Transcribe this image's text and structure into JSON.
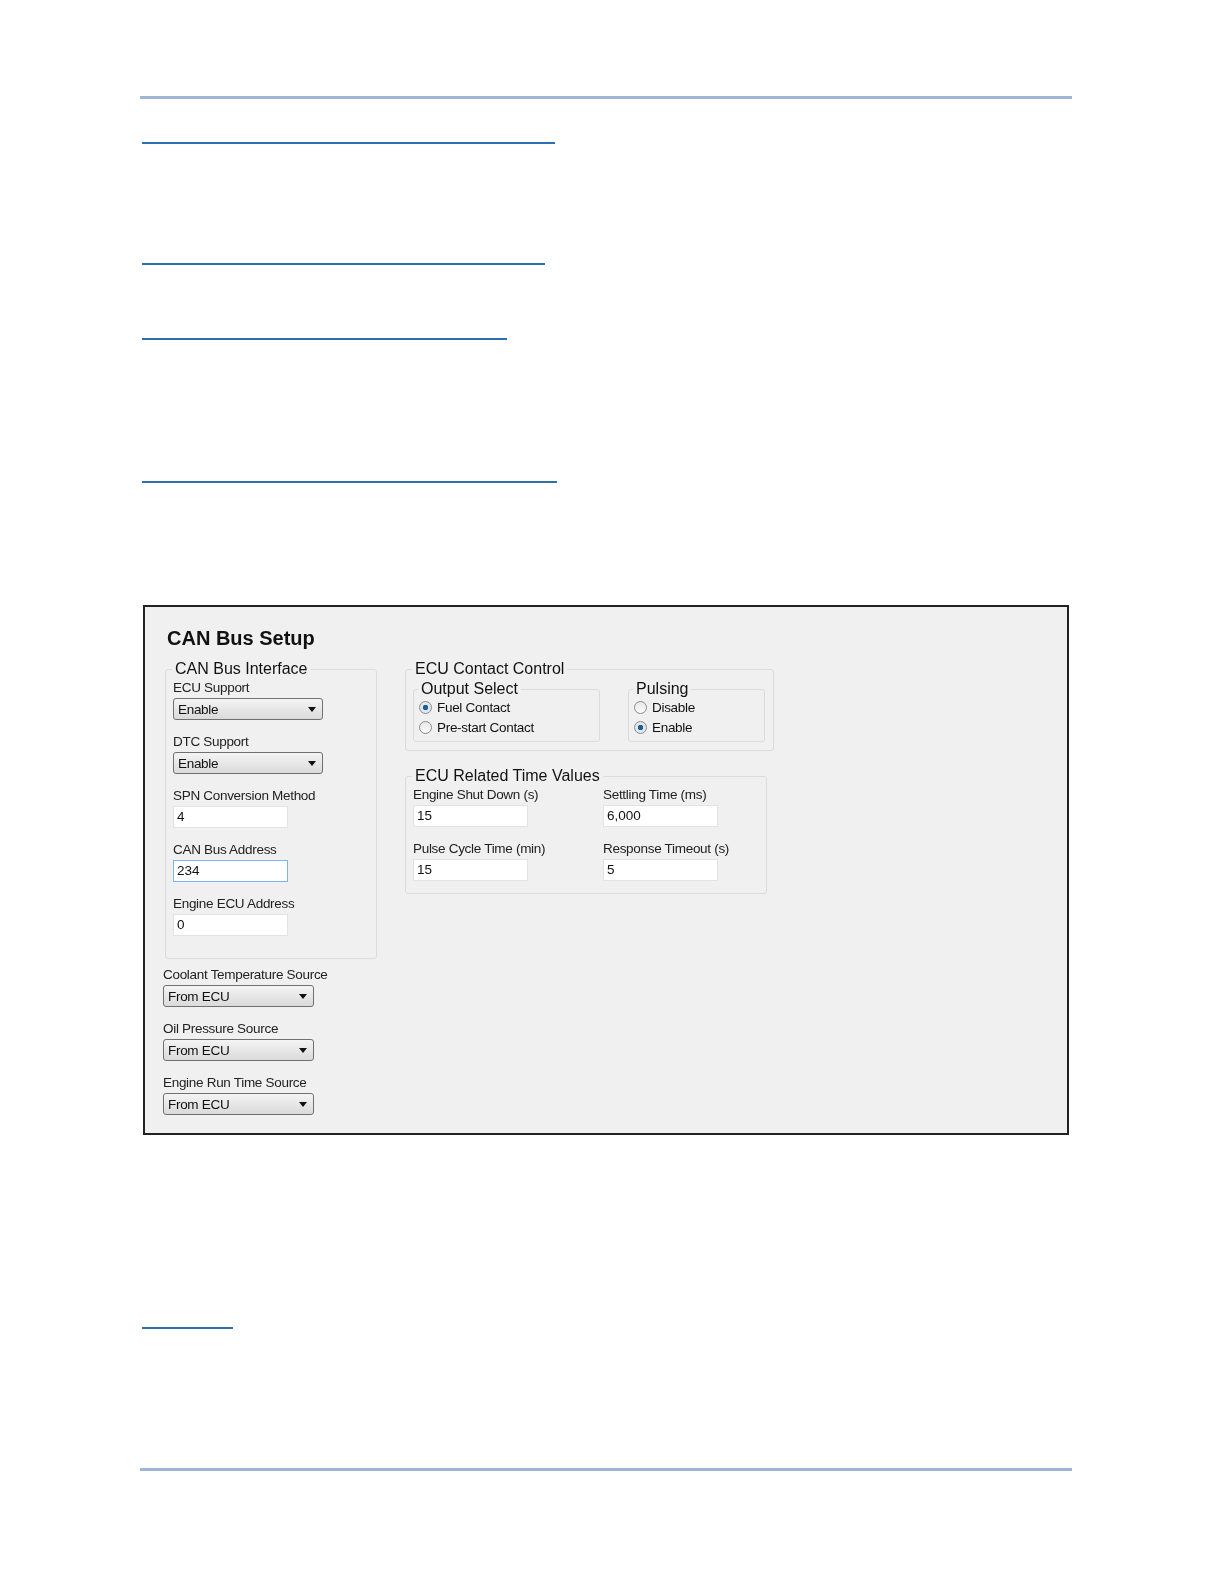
{
  "title": "CAN Bus Setup",
  "can_bus_interface": {
    "title": "CAN Bus Interface",
    "fields": [
      {
        "kind": "dropdown",
        "label": "ECU Support",
        "value": "Enable"
      },
      {
        "kind": "dropdown",
        "label": "DTC Support",
        "value": "Enable"
      },
      {
        "kind": "text",
        "label": "SPN Conversion Method",
        "value": "4",
        "focused": false
      },
      {
        "kind": "text",
        "label": "CAN Bus Address",
        "value": "234",
        "focused": true
      },
      {
        "kind": "text",
        "label": "Engine ECU Address",
        "value": "0",
        "focused": false
      }
    ]
  },
  "sources": [
    {
      "label": "Coolant Temperature Source",
      "value": "From ECU"
    },
    {
      "label": "Oil Pressure Source",
      "value": "From ECU"
    },
    {
      "label": "Engine Run Time Source",
      "value": "From ECU"
    }
  ],
  "ecu_contact_control": {
    "title": "ECU Contact Control",
    "output_select": {
      "title": "Output Select",
      "options": [
        {
          "label": "Fuel Contact",
          "selected": true
        },
        {
          "label": "Pre-start Contact",
          "selected": false
        }
      ]
    },
    "pulsing": {
      "title": "Pulsing",
      "options": [
        {
          "label": "Disable",
          "selected": false
        },
        {
          "label": "Enable",
          "selected": true
        }
      ]
    }
  },
  "time_values": {
    "title": "ECU Related Time Values",
    "fields": [
      {
        "label": "Engine Shut Down (s)",
        "value": "15",
        "focused": false
      },
      {
        "label": "Settling Time (ms)",
        "value": "6,000",
        "focused": false
      },
      {
        "label": "Pulse Cycle Time (min)",
        "value": "15",
        "focused": false
      },
      {
        "label": "Response Timeout (s)",
        "value": "5",
        "focused": false
      }
    ]
  }
}
